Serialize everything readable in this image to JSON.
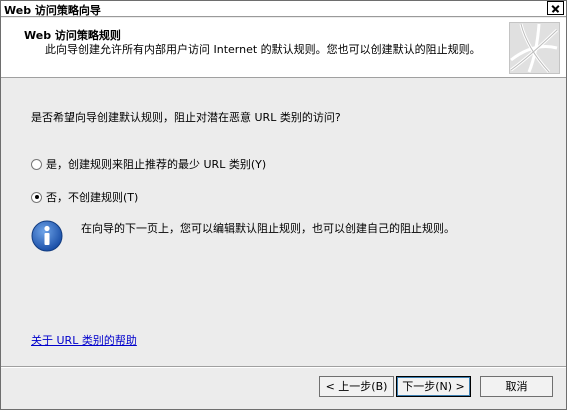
{
  "window": {
    "title": "Web 访问策略向导",
    "close_icon": "close-icon"
  },
  "header": {
    "title": "Web 访问策略规则",
    "description": "此向导创建允许所有内部用户访问 Internet 的默认规则。您也可以创建默认的阻止规则。",
    "graphic_icon": "wizard-graphic-icon"
  },
  "main": {
    "question": "是否希望向导创建默认规则，阻止对潜在恶意 URL 类别的访问?",
    "options": [
      {
        "label": "是，创建规则来阻止推荐的最少 URL 类别(Y)",
        "checked": false
      },
      {
        "label": "否，不创建规则(T)",
        "checked": true
      }
    ],
    "info_icon": "info-icon",
    "info_text": "在向导的下一页上，您可以编辑默认阻止规则，也可以创建自己的阻止规则。",
    "help_link": "关于 URL 类别的帮助"
  },
  "footer": {
    "back_label": "< 上一步(B)",
    "next_label": "下一步(N) >",
    "cancel_label": "取消"
  },
  "colors": {
    "link": "#0000cc",
    "info_blue": "#1a4fa8",
    "dialog_bg": "#ececec"
  }
}
